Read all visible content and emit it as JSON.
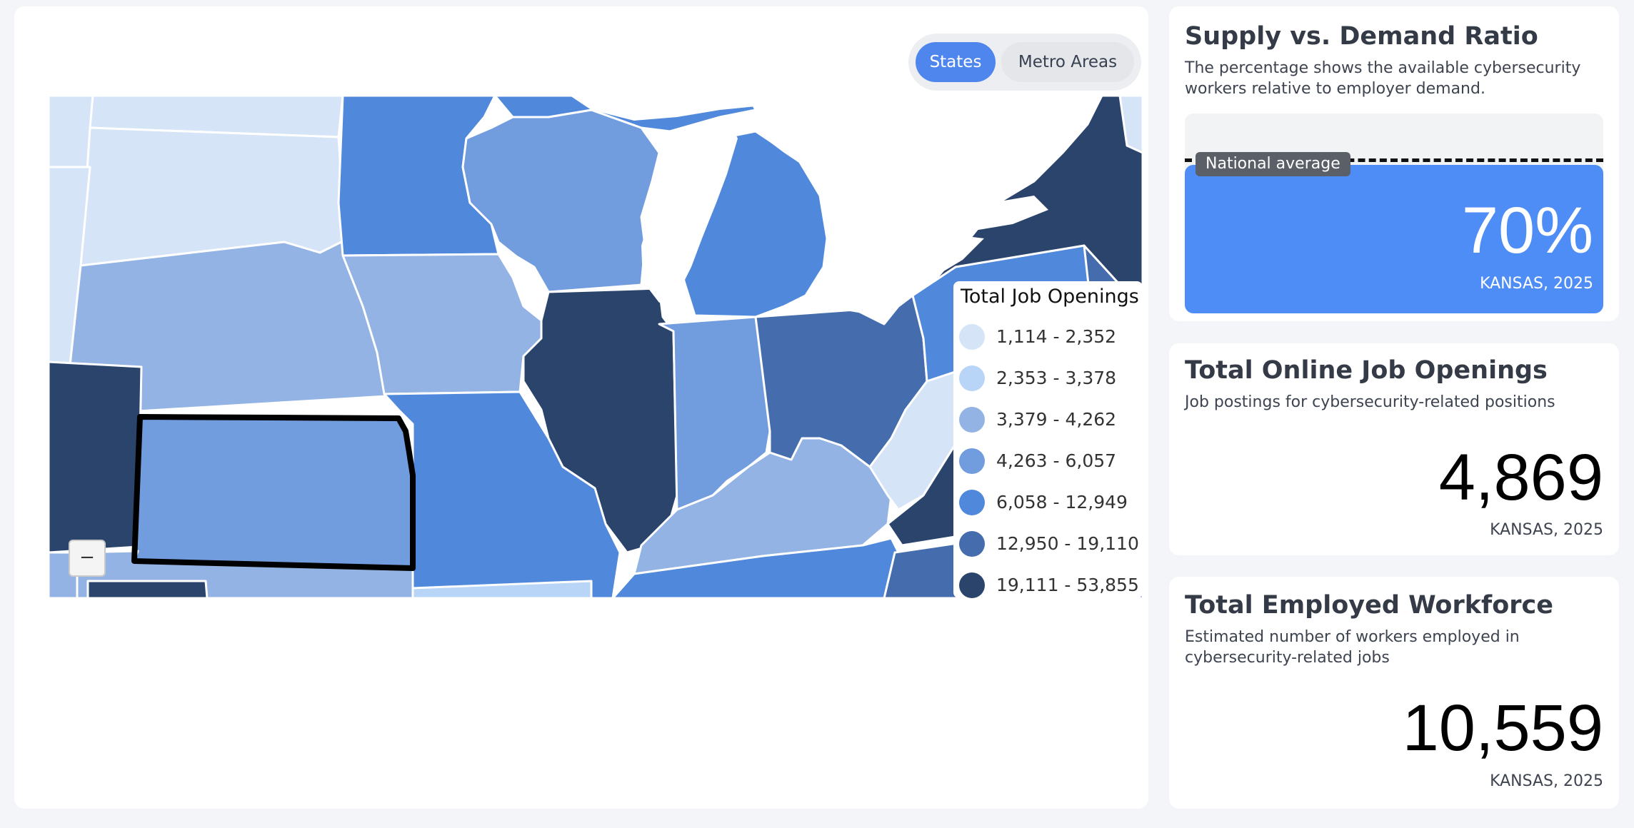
{
  "map": {
    "toggle": {
      "states_label": "States",
      "metro_label": "Metro Areas",
      "active": "States"
    },
    "zoom_out_label": "−",
    "legend": {
      "title": "Total Job Openings",
      "items": [
        {
          "label": "1,114 - 2,352",
          "color": "#d5e4f7"
        },
        {
          "label": "2,353 - 3,378",
          "color": "#b8d4f6"
        },
        {
          "label": "3,379 - 4,262",
          "color": "#93b3e4"
        },
        {
          "label": "4,263 - 6,057",
          "color": "#719cdd"
        },
        {
          "label": "6,058 - 12,949",
          "color": "#5089dc"
        },
        {
          "label": "12,950 - 19,110",
          "color": "#456dad"
        },
        {
          "label": "19,111 - 53,855",
          "color": "#2a446c"
        }
      ]
    },
    "selected_state": "Kansas"
  },
  "ratio": {
    "title": "Supply vs. Demand Ratio",
    "description": "The percentage shows the available cybersecurity workers relative to employer demand.",
    "national_average_label": "National average",
    "value": "70%",
    "value_number": 70,
    "context": "KANSAS, 2025",
    "fill_color": "#4f8df6"
  },
  "openings": {
    "title": "Total Online Job Openings",
    "description": "Job postings for cybersecurity-related positions",
    "value": "4,869",
    "context": "KANSAS, 2025"
  },
  "workforce": {
    "title": "Total Employed Workforce",
    "description": "Estimated number of workers employed in cybersecurity-related jobs",
    "value": "10,559",
    "context": "KANSAS, 2025"
  }
}
